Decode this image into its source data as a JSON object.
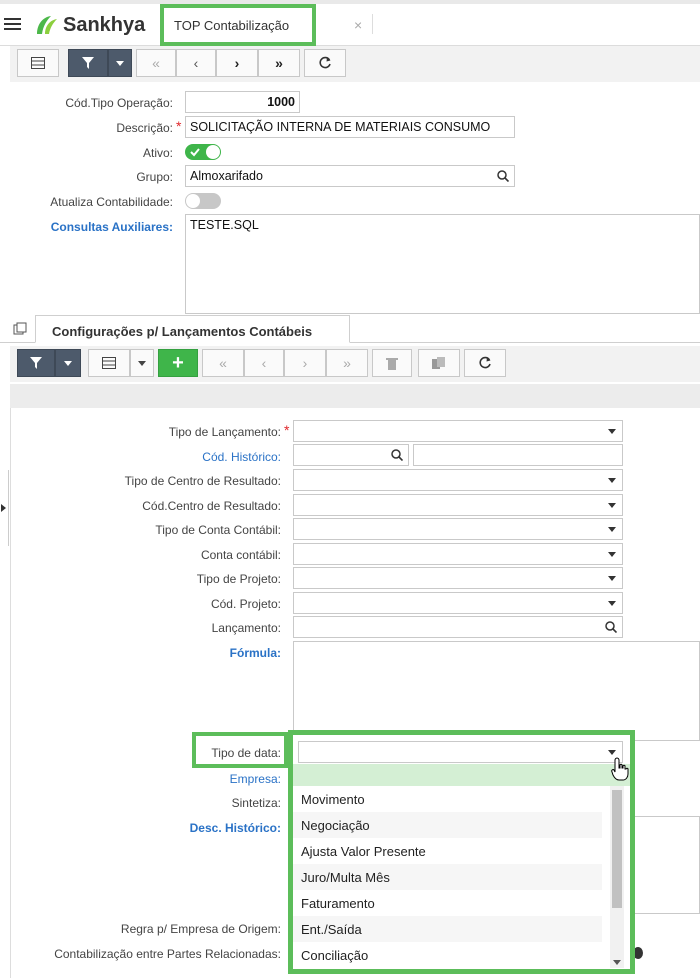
{
  "app": {
    "brand": "Sankhya",
    "tab_title": "TOP Contabilização",
    "tab_close": "×"
  },
  "toolbar1": {
    "buttons": [
      "grid-icon",
      "filter-icon",
      "first-icon",
      "prev-icon",
      "next-icon",
      "last-icon",
      "refresh-icon"
    ]
  },
  "form": {
    "cod_tipo_label": "Cód.Tipo Operação:",
    "cod_tipo_value": "1000",
    "descricao_label": "Descrição:",
    "descricao_value": "SOLICITAÇÃO INTERNA DE MATERIAIS CONSUMO",
    "ativo_label": "Ativo:",
    "ativo_on": true,
    "grupo_label": "Grupo:",
    "grupo_value": "Almoxarifado",
    "atualiza_label": "Atualiza Contabilidade:",
    "atualiza_on": false,
    "consultas_label": "Consultas Auxiliares:",
    "consultas_value": "TESTE.SQL"
  },
  "detail": {
    "tab_label": "Configurações p/ Lançamentos Contábeis",
    "tipo_lanc_label": "Tipo de Lançamento:",
    "cod_hist_label": "Cód. Histórico:",
    "tipo_centro_label": "Tipo de Centro de Resultado:",
    "cod_centro_label": "Cód.Centro de Resultado:",
    "tipo_conta_label": "Tipo de Conta Contábil:",
    "conta_label": "Conta contábil:",
    "tipo_proj_label": "Tipo de Projeto:",
    "cod_proj_label": "Cód. Projeto:",
    "lancamento_label": "Lançamento:",
    "formula_label": "Fórmula:",
    "tipo_data_label": "Tipo de data:",
    "empresa_label": "Empresa:",
    "sintetiza_label": "Sintetiza:",
    "desc_hist_label": "Desc. Histórico:",
    "regra_label": "Regra p/ Empresa de Origem:",
    "contab_label": "Contabilização entre Partes Relacionadas:"
  },
  "dropdown": {
    "options": [
      "Movimento",
      "Negociação",
      "Ajusta Valor Presente",
      "Juro/Multa Mês",
      "Faturamento",
      "Ent./Saída",
      "Conciliação"
    ]
  },
  "colors": {
    "accent_green": "#5cbd5a",
    "link_blue": "#2a72c6",
    "dark_button": "#4d5a6b"
  }
}
